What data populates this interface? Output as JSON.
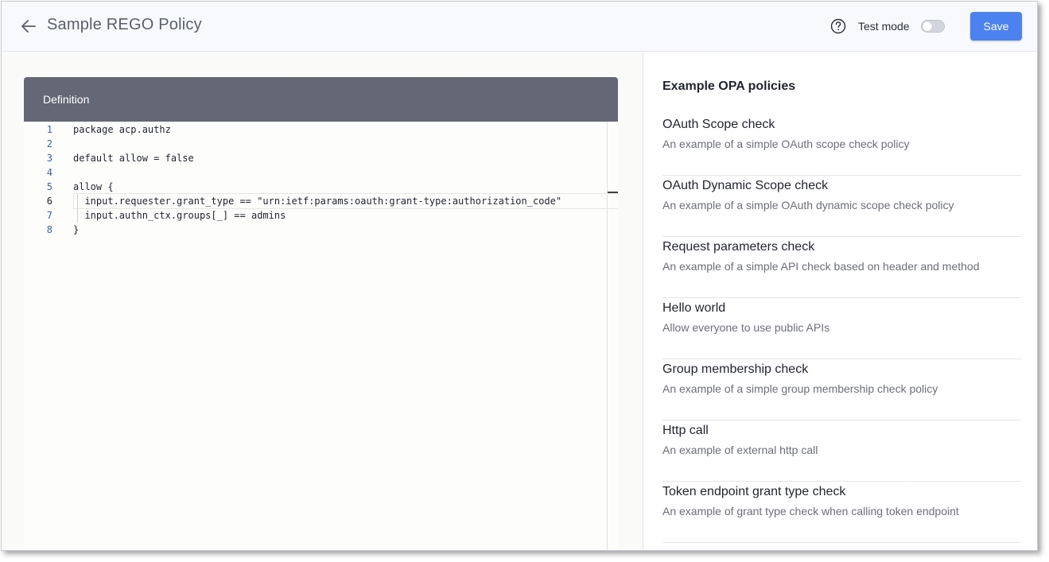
{
  "header": {
    "title": "Sample REGO Policy",
    "test_mode_label": "Test mode",
    "test_mode_on": false,
    "save_label": "Save"
  },
  "editor": {
    "title": "Definition",
    "active_line": 6,
    "lines": [
      {
        "num": "1",
        "text": "package acp.authz"
      },
      {
        "num": "2",
        "text": ""
      },
      {
        "num": "3",
        "text": "default allow = false"
      },
      {
        "num": "4",
        "text": ""
      },
      {
        "num": "5",
        "text": "allow {"
      },
      {
        "num": "6",
        "text": "  input.requester.grant_type == \"urn:ietf:params:oauth:grant-type:authorization_code\""
      },
      {
        "num": "7",
        "text": "  input.authn_ctx.groups[_] == admins"
      },
      {
        "num": "8",
        "text": "}"
      }
    ]
  },
  "examples": {
    "title": "Example OPA policies",
    "items": [
      {
        "name": "OAuth Scope check",
        "desc": "An example of a simple OAuth scope check policy"
      },
      {
        "name": "OAuth Dynamic Scope check",
        "desc": "An example of a simple OAuth dynamic scope check policy"
      },
      {
        "name": "Request parameters check",
        "desc": "An example of a simple API check based on header and method"
      },
      {
        "name": "Hello world",
        "desc": "Allow everyone to use public APIs"
      },
      {
        "name": "Group membership check",
        "desc": "An example of a simple group membership check policy"
      },
      {
        "name": "Http call",
        "desc": "An example of external http call"
      },
      {
        "name": "Token endpoint grant type check",
        "desc": "An example of grant type check when calling token endpoint"
      }
    ]
  },
  "colors": {
    "accent": "#4b82f0",
    "editor_header": "#646775",
    "line_number": "#3a62b8"
  }
}
